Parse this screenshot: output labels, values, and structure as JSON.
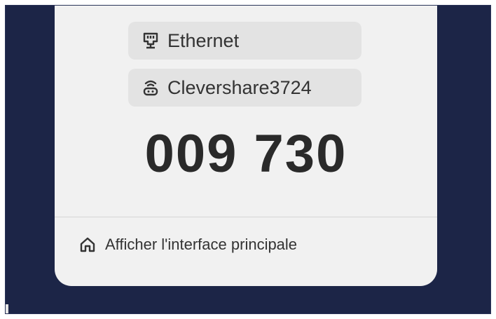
{
  "network": {
    "ethernet_label": "Ethernet",
    "ethernet_icon": "ethernet-icon",
    "wifi_label": "Clevershare3724",
    "wifi_icon": "wireless-router-icon"
  },
  "pairing": {
    "code": "009 730"
  },
  "footer": {
    "show_main_label": "Afficher l'interface principale",
    "show_main_icon": "home-icon"
  },
  "colors": {
    "background": "#1c2547",
    "card": "#f1f1f1",
    "pill": "#e3e3e3",
    "text": "#2a2a2a"
  }
}
